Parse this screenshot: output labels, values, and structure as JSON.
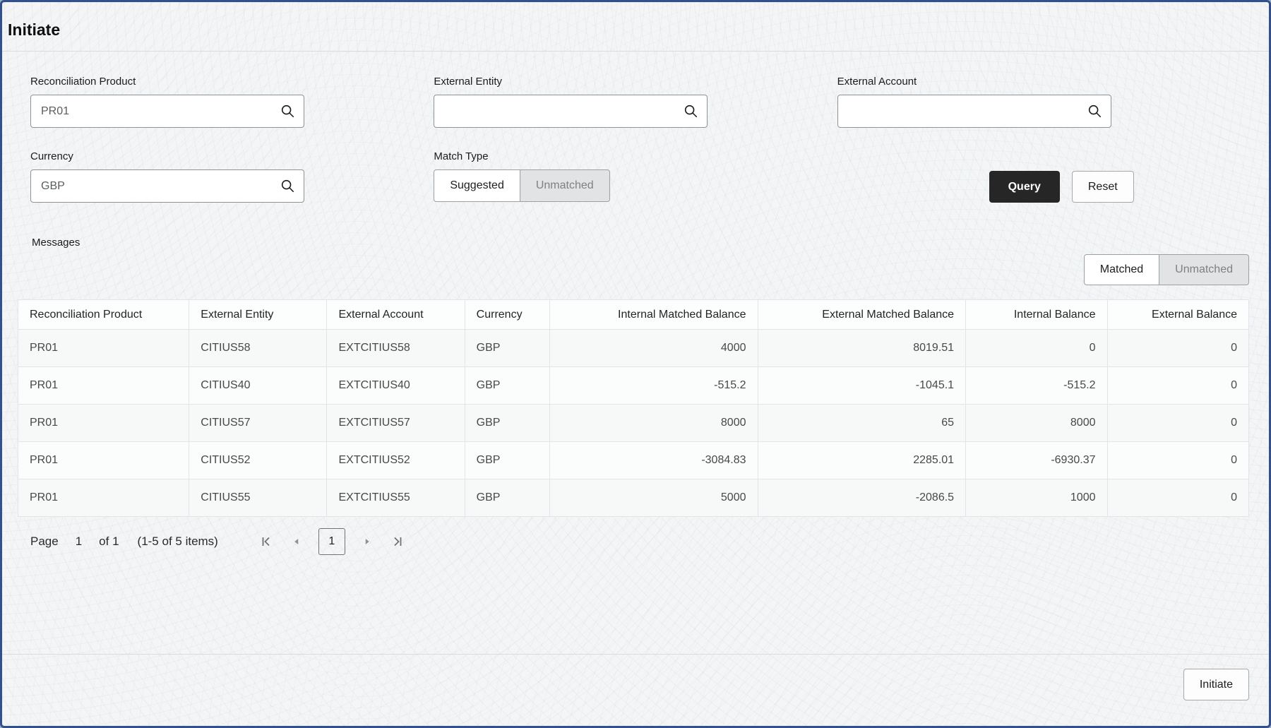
{
  "page": {
    "title": "Initiate"
  },
  "filters": {
    "reconciliation_product": {
      "label": "Reconciliation Product",
      "value": "PR01"
    },
    "external_entity": {
      "label": "External Entity",
      "value": ""
    },
    "external_account": {
      "label": "External Account",
      "value": ""
    },
    "currency": {
      "label": "Currency",
      "value": "GBP"
    },
    "match_type": {
      "label": "Match Type",
      "options": [
        "Suggested",
        "Unmatched"
      ],
      "selected": "Suggested"
    },
    "actions": {
      "query_label": "Query",
      "reset_label": "Reset"
    }
  },
  "messages": {
    "section_label": "Messages",
    "view_toggle": {
      "options": [
        "Matched",
        "Unmatched"
      ],
      "selected": "Matched"
    }
  },
  "table": {
    "columns": [
      "Reconciliation Product",
      "External Entity",
      "External Account",
      "Currency",
      "Internal Matched Balance",
      "External Matched Balance",
      "Internal Balance",
      "External Balance"
    ],
    "rows": [
      [
        "PR01",
        "CITIUS58",
        "EXTCITIUS58",
        "GBP",
        "4000",
        "8019.51",
        "0",
        "0"
      ],
      [
        "PR01",
        "CITIUS40",
        "EXTCITIUS40",
        "GBP",
        "-515.2",
        "-1045.1",
        "-515.2",
        "0"
      ],
      [
        "PR01",
        "CITIUS57",
        "EXTCITIUS57",
        "GBP",
        "8000",
        "65",
        "8000",
        "0"
      ],
      [
        "PR01",
        "CITIUS52",
        "EXTCITIUS52",
        "GBP",
        "-3084.83",
        "2285.01",
        "-6930.37",
        "0"
      ],
      [
        "PR01",
        "CITIUS55",
        "EXTCITIUS55",
        "GBP",
        "5000",
        "-2086.5",
        "1000",
        "0"
      ]
    ]
  },
  "pagination": {
    "page_label": "Page",
    "current_page": "1",
    "of_text": "of 1",
    "range_text": "(1-5 of 5 items)",
    "page_button": "1"
  },
  "footer": {
    "initiate_label": "Initiate"
  },
  "icons": {
    "search": "search-icon",
    "first_page": "first-page-icon",
    "prev_page": "previous-page-icon",
    "next_page": "next-page-icon",
    "last_page": "last-page-icon"
  },
  "colors": {
    "window_border": "#33508e",
    "primary_button_bg": "#262626",
    "primary_button_text": "#ffffff",
    "inactive_toggle_bg": "#e2e3e4",
    "table_border": "#e2e5e7",
    "background": "#f3f5f6"
  }
}
